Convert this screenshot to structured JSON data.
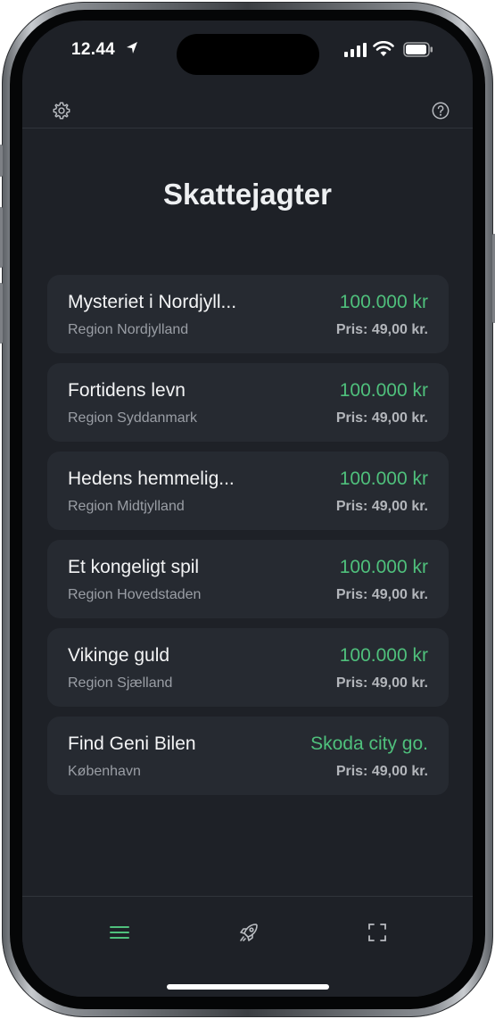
{
  "status_bar": {
    "time": "12.44"
  },
  "header": {
    "title": "Skattejagter"
  },
  "hunts": [
    {
      "name": "Mysteriet i Nordjyll...",
      "region": "Region Nordjylland",
      "prize": "100.000 kr",
      "price": "Pris: 49,00 kr."
    },
    {
      "name": "Fortidens levn",
      "region": "Region Syddanmark",
      "prize": "100.000 kr",
      "price": "Pris: 49,00 kr."
    },
    {
      "name": "Hedens hemmelig...",
      "region": "Region Midtjylland",
      "prize": "100.000 kr",
      "price": "Pris: 49,00 kr."
    },
    {
      "name": "Et kongeligt spil",
      "region": "Region Hovedstaden",
      "prize": "100.000 kr",
      "price": "Pris: 49,00 kr."
    },
    {
      "name": "Vikinge guld",
      "region": "Region Sjælland",
      "prize": "100.000 kr",
      "price": "Pris: 49,00 kr."
    },
    {
      "name": "Find Geni Bilen",
      "region": "København",
      "prize": "Skoda city go.",
      "price": "Pris: 49,00 kr."
    }
  ],
  "tabs": [
    {
      "icon": "list-icon",
      "active": true
    },
    {
      "icon": "rocket-icon",
      "active": false
    },
    {
      "icon": "scan-icon",
      "active": false
    }
  ],
  "colors": {
    "background": "#1e2127",
    "card": "#262a31",
    "accent_green": "#4fc07c"
  }
}
